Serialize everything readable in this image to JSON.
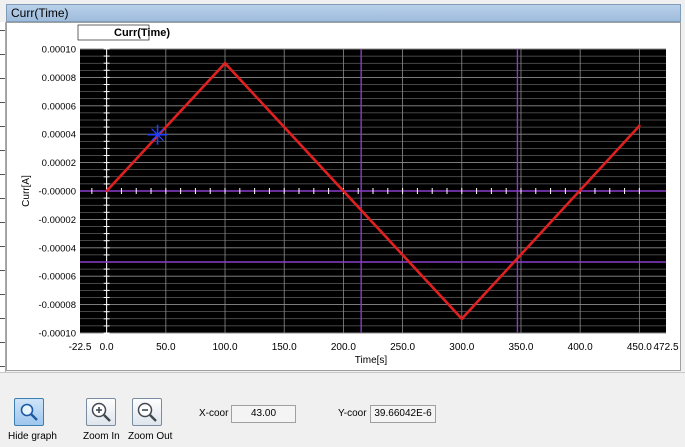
{
  "window": {
    "title": "Curr(Time)"
  },
  "chart_data": {
    "type": "line",
    "title": "Curr(Time)",
    "xlabel": "Time[s]",
    "ylabel": "Curr[A]",
    "xlim": [
      -22.5,
      472.5
    ],
    "ylim": [
      -0.0001,
      0.0001
    ],
    "x_ticks": [
      "-22.5",
      "0.0",
      "50.0",
      "100.0",
      "150.0",
      "200.0",
      "250.0",
      "300.0",
      "350.0",
      "400.0",
      "450.0",
      "472.5"
    ],
    "y_ticks": [
      "0.00010",
      "0.00008",
      "0.00006",
      "0.00004",
      "0.00002",
      "-0.00000",
      "-0.00002",
      "-0.00004",
      "-0.00006",
      "-0.00008",
      "-0.00010"
    ],
    "grid": true,
    "background": "#000000",
    "series": [
      {
        "color": "#e02020",
        "x": [
          0,
          100,
          300,
          450
        ],
        "y": [
          0.0,
          9e-05,
          -9e-05,
          4.592e-05
        ]
      }
    ],
    "cursor_marker": {
      "x": 43.0,
      "y": 3.96604e-05
    },
    "guides": {
      "vertical_x": [
        215,
        347
      ],
      "horizontal_y": [
        0.0,
        -5e-05
      ]
    }
  },
  "toolbar": {
    "hide_graph_label": "Hide graph",
    "zoom_in_label": "Zoom In",
    "zoom_out_label": "Zoom Out",
    "xcoor_label": "X-coor",
    "xcoor_value": "43.00",
    "ycoor_label": "Y-coor",
    "ycoor_value": "39.66042E-6"
  },
  "colors": {
    "plot_bg": "#000000",
    "line": "#e02020",
    "guide": "#8a3cc8",
    "marker": "#2040ff",
    "grid": "#8c8c8c"
  }
}
